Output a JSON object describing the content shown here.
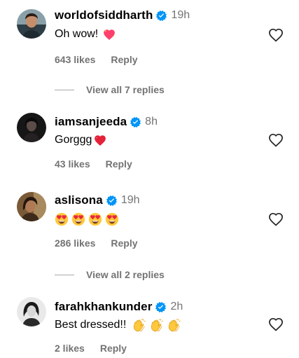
{
  "comments": [
    {
      "username": "worldofsiddharth",
      "verified": true,
      "time": "19h",
      "text": "Oh wow!",
      "emojis": [
        "heart-with-sparkles"
      ],
      "likes": "643 likes",
      "reply": "Reply",
      "view_replies": "View all 7 replies"
    },
    {
      "username": "iamsanjeeda",
      "verified": true,
      "time": "8h",
      "text": "Gorggg",
      "emojis": [
        "red-heart"
      ],
      "likes": "43 likes",
      "reply": "Reply"
    },
    {
      "username": "aslisona",
      "verified": true,
      "time": "19h",
      "text": "",
      "emojis": [
        "heart-eyes",
        "heart-eyes",
        "heart-eyes",
        "heart-eyes"
      ],
      "likes": "286 likes",
      "reply": "Reply",
      "view_replies": "View all 2 replies"
    },
    {
      "username": "farahkhankunder",
      "verified": true,
      "time": "2h",
      "text": "Best dressed!!",
      "emojis": [
        "clapping-hands",
        "clapping-hands",
        "clapping-hands"
      ],
      "likes": "2 likes",
      "reply": "Reply"
    }
  ],
  "colors": {
    "verified": "#0095F6",
    "secondary_text": "#737373",
    "like_outline": "#262626"
  },
  "icons": {
    "like": "heart-outline-icon",
    "verified": "verified-badge-icon"
  }
}
